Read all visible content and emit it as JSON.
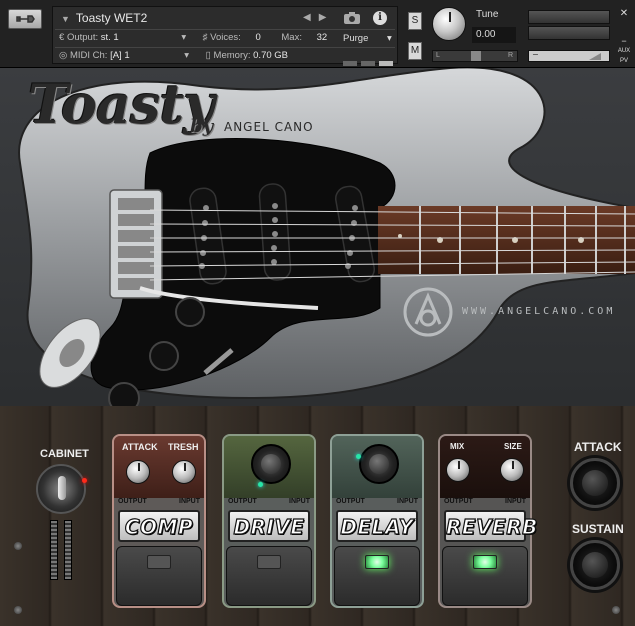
{
  "header": {
    "instrument_name": "Toasty WET2",
    "output_label": "Output:",
    "output_value": "st. 1",
    "voices_label": "Voices:",
    "voices_value": "0",
    "max_label": "Max:",
    "max_value": "32",
    "purge_label": "Purge",
    "midi_label": "MIDI Ch:",
    "midi_value": "[A] 1",
    "memory_label": "Memory:",
    "memory_value": "0.70 GB",
    "solo_label": "S",
    "mute_label": "M",
    "tune_label": "Tune",
    "tune_value": "0.00",
    "pan_left": "L",
    "pan_right": "R",
    "aux_label": "AUX",
    "pv_label": "PV"
  },
  "branding": {
    "logo": "Toasty",
    "by": "by",
    "author": "ANGEL CANO",
    "website": "WWW.ANGELCANO.COM"
  },
  "cabinet": {
    "label": "CABINET"
  },
  "pedals": {
    "comp": {
      "name": "COMP",
      "knob1": "ATTACK",
      "knob2": "TRESH",
      "output": "OUTPUT",
      "input": "INPUT"
    },
    "drive": {
      "name": "DRIVE",
      "output": "OUTPUT",
      "input": "INPUT"
    },
    "delay": {
      "name": "DELAY",
      "output": "OUTPUT",
      "input": "INPUT"
    },
    "reverb": {
      "name": "REVERB",
      "knob1": "MIX",
      "knob2": "SIZE",
      "output": "OUTPUT",
      "input": "INPUT"
    }
  },
  "amp": {
    "attack": "ATTACK",
    "sustain": "SUSTAIN"
  },
  "colors": {
    "comp_top": "#5a2f28",
    "drive_top": "#4b5a3a",
    "delay_top": "#4a5a50",
    "reverb_top": "#2c1a16",
    "led_green": "#7aff9c"
  }
}
